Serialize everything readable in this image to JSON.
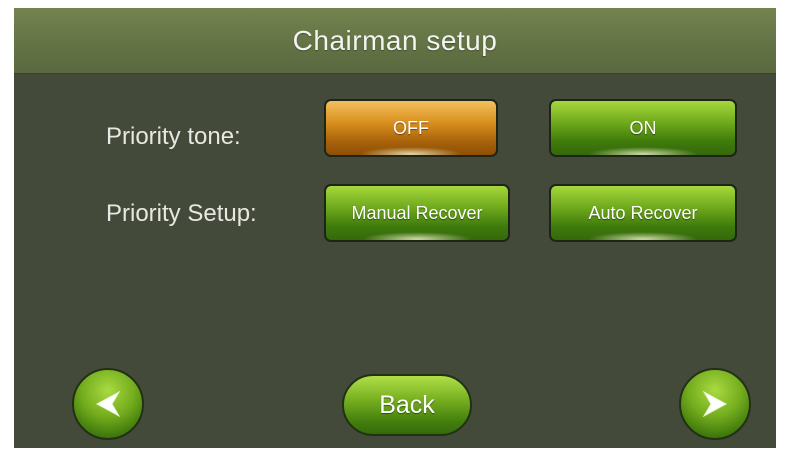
{
  "header": {
    "title": "Chairman setup"
  },
  "priority_tone": {
    "label": "Priority tone:",
    "off_label": "OFF",
    "on_label": "ON",
    "selected": "OFF"
  },
  "priority_setup": {
    "label": "Priority Setup:",
    "manual_label": "Manual Recover",
    "auto_label": "Auto Recover"
  },
  "nav": {
    "back_label": "Back",
    "prev_icon": "left-arrow-icon",
    "next_icon": "right-arrow-icon"
  },
  "colors": {
    "background": "#434a39",
    "header": "#627244",
    "green_button": "#6fa91c",
    "orange_button": "#d9901e",
    "text": "#e8e8e3"
  }
}
